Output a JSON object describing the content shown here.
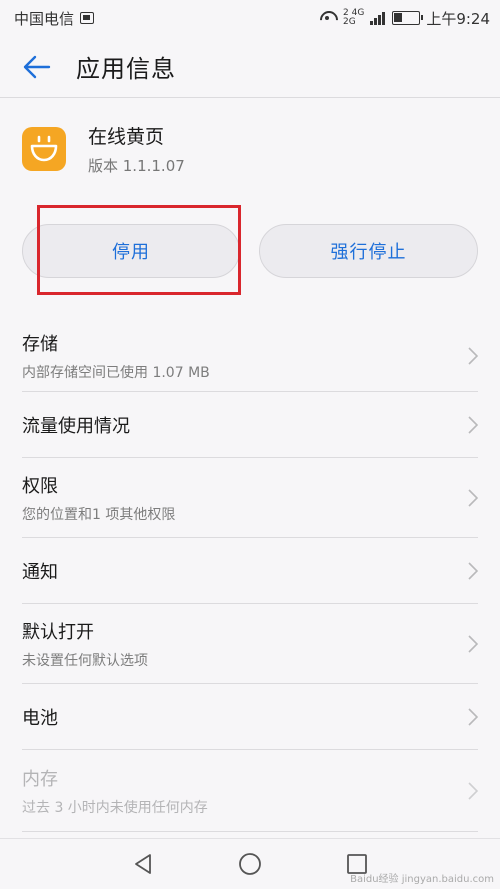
{
  "status_bar": {
    "carrier": "中国电信",
    "network_top": "2 4G",
    "network_bottom": "2G",
    "time": "上午9:24",
    "battery_level": 0.35
  },
  "header": {
    "title": "应用信息"
  },
  "app": {
    "name": "在线黄页",
    "version": "版本 1.1.1.07",
    "icon_color": "#f5a623"
  },
  "buttons": {
    "disable_label": "停用",
    "force_stop_label": "强行停止"
  },
  "settings": {
    "storage": {
      "title": "存储",
      "subtitle": "内部存储空间已使用 1.07 MB"
    },
    "data_usage": {
      "title": "流量使用情况"
    },
    "permissions": {
      "title": "权限",
      "subtitle": "您的位置和1 项其他权限"
    },
    "notifications": {
      "title": "通知"
    },
    "open_by_default": {
      "title": "默认打开",
      "subtitle": "未设置任何默认选项"
    },
    "battery": {
      "title": "电池"
    },
    "memory": {
      "title": "内存",
      "subtitle": "过去 3 小时内未使用任何内存"
    }
  },
  "colors": {
    "accent": "#1e6fd9",
    "highlight": "#d9262d"
  },
  "watermark": "Baidu经验 jingyan.baidu.com"
}
